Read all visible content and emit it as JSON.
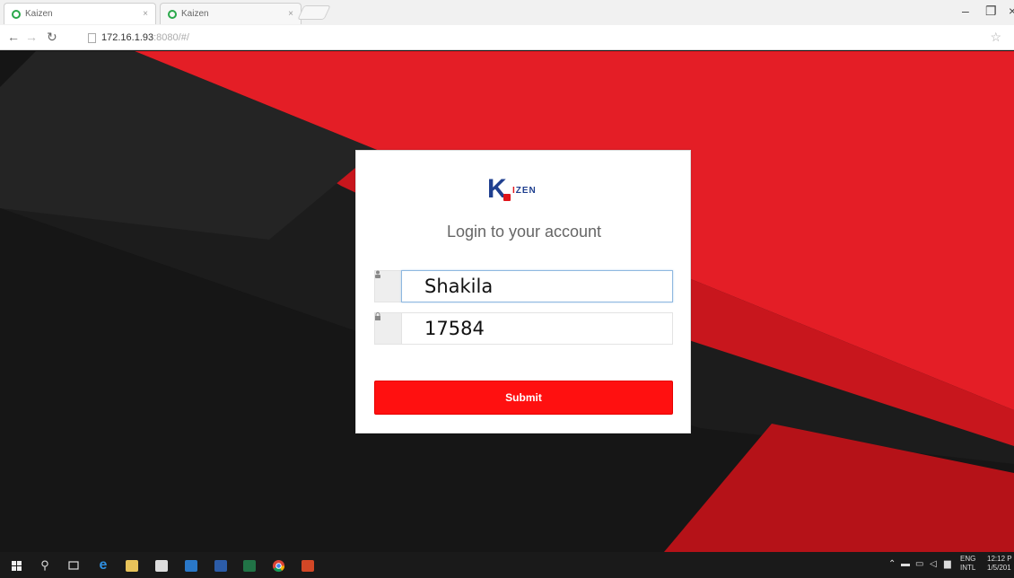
{
  "browser": {
    "tabs": [
      {
        "label": "Kaizen"
      },
      {
        "label": "Kaizen"
      }
    ],
    "url_host": "172.16.1.93",
    "url_rest": ":8080/#/"
  },
  "login": {
    "logo_k": "K",
    "logo_i": "I",
    "logo_zen": "ZEN",
    "title": "Login to your account",
    "username_value": "Shakila",
    "password_value": "17584",
    "submit_label": "Submit"
  },
  "taskbar": {
    "lang_line1": "ENG",
    "lang_line2": "INTL",
    "time": "12:12 P",
    "date": "1/5/201"
  },
  "colors": {
    "brand_red": "#ff1010",
    "brand_blue": "#1f3f8f"
  }
}
